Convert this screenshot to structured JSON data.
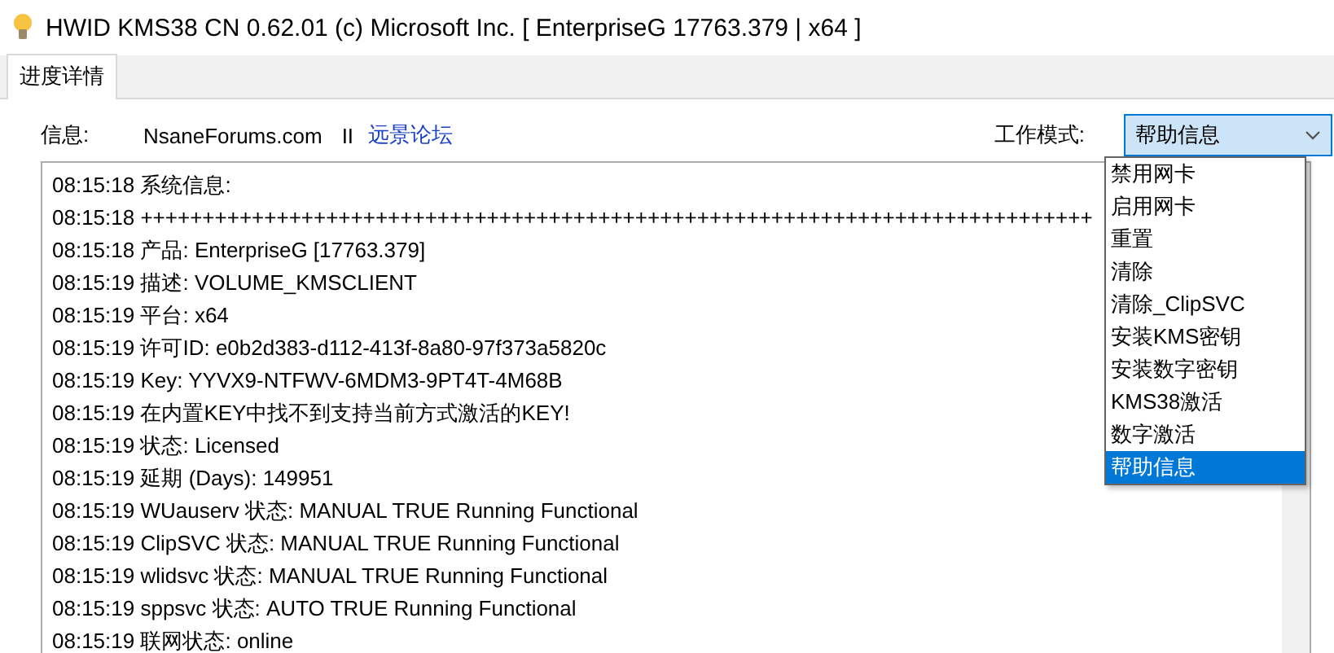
{
  "window": {
    "title": "HWID KMS38 CN 0.62.01 (c) Microsoft Inc. [ EnterpriseG 17763.379 | x64 ]"
  },
  "tabs": [
    {
      "label": "进度详情",
      "selected": true
    }
  ],
  "info": {
    "label": "信息:",
    "site": "NsaneForums.com",
    "separator": "II",
    "link": "远景论坛"
  },
  "mode": {
    "label": "工作模式:",
    "value": "帮助信息",
    "expanded": true,
    "options": [
      {
        "label": "禁用网卡",
        "selected": false
      },
      {
        "label": "启用网卡",
        "selected": false
      },
      {
        "label": "重置",
        "selected": false
      },
      {
        "label": "清除",
        "selected": false
      },
      {
        "label": "清除_ClipSVC",
        "selected": false
      },
      {
        "label": "安装KMS密钥",
        "selected": false
      },
      {
        "label": "安装数字密钥",
        "selected": false
      },
      {
        "label": "KMS38激活",
        "selected": false
      },
      {
        "label": "数字激活",
        "selected": false
      },
      {
        "label": "帮助信息",
        "selected": true
      }
    ]
  },
  "log": [
    "08:15:18 系统信息:",
    "08:15:18 +++++++++++++++++++++++++++++++++++++++++++++++++++++++++++++++++++++++++++++",
    "08:15:18 产品: EnterpriseG [17763.379]",
    "08:15:19 描述: VOLUME_KMSCLIENT",
    "08:15:19 平台: x64",
    "08:15:19 许可ID: e0b2d383-d112-413f-8a80-97f373a5820c",
    "08:15:19 Key: YYVX9-NTFWV-6MDM3-9PT4T-4M68B",
    "08:15:19 在内置KEY中找不到支持当前方式激活的KEY!",
    "08:15:19 状态: Licensed",
    "08:15:19 延期 (Days): 149951",
    "08:15:19 WUauserv 状态: MANUAL TRUE Running Functional",
    "08:15:19 ClipSVC 状态: MANUAL TRUE Running Functional",
    "08:15:19 wlidsvc 状态: MANUAL TRUE Running Functional",
    "08:15:19 sppsvc 状态: AUTO TRUE Running Functional",
    "08:15:19 联网状态: online"
  ]
}
